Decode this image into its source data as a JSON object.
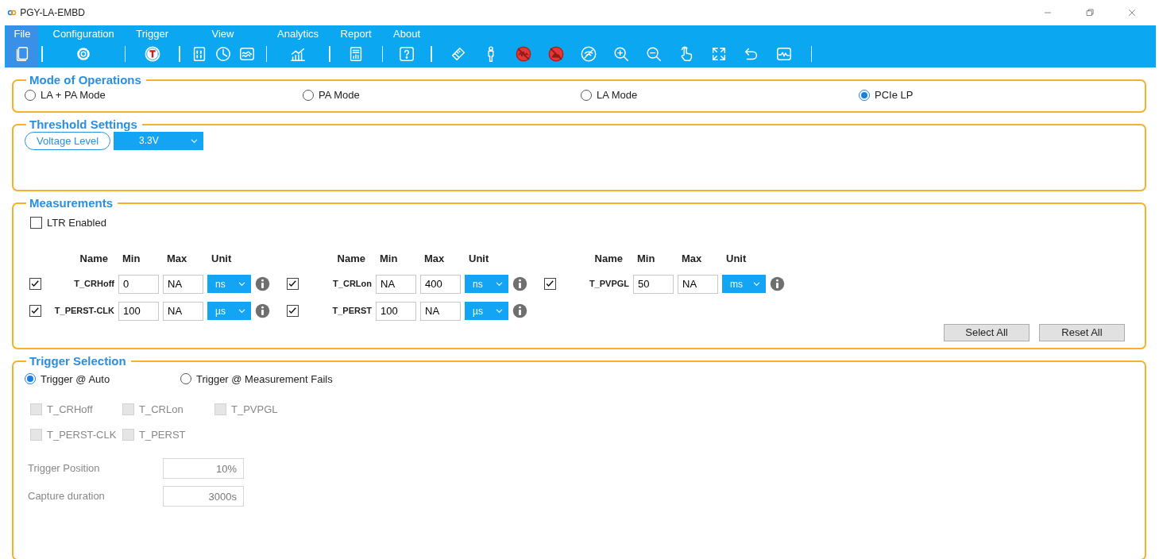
{
  "window": {
    "title": "PGY-LA-EMBD"
  },
  "menu": [
    {
      "label": "File",
      "selected": true
    },
    {
      "label": "Configuration",
      "selected": false
    },
    {
      "label": "Trigger",
      "selected": false
    },
    {
      "label": "View",
      "selected": false
    },
    {
      "label": "Analytics",
      "selected": false
    },
    {
      "label": "Report",
      "selected": false
    },
    {
      "label": "About",
      "selected": false
    }
  ],
  "mode_of_operations": {
    "title": "Mode of Operations",
    "options": [
      {
        "label": "LA + PA Mode",
        "selected": false
      },
      {
        "label": "PA Mode",
        "selected": false
      },
      {
        "label": "LA Mode",
        "selected": false
      },
      {
        "label": "PCIe LP",
        "selected": true
      }
    ]
  },
  "threshold_settings": {
    "title": "Threshold Settings",
    "voltage_label": "Voltage Level",
    "voltage_value": "3.3V"
  },
  "measurements": {
    "title": "Measurements",
    "ltr": {
      "label": "LTR Enabled",
      "checked": false
    },
    "groups": [
      {
        "headers": [
          "Name",
          "Min",
          "Max",
          "Unit"
        ],
        "items": [
          {
            "name": "T_CRHoff",
            "checked": true,
            "min": "0",
            "max": "NA",
            "unit": "ns"
          },
          {
            "name": "T_PERST-CLK",
            "checked": true,
            "min": "100",
            "max": "NA",
            "unit": "µs"
          }
        ]
      },
      {
        "headers": [
          "Name",
          "Min",
          "Max",
          "Unit"
        ],
        "items": [
          {
            "name": "T_CRLon",
            "checked": true,
            "min": "NA",
            "max": "400",
            "unit": "ns"
          },
          {
            "name": "T_PERST",
            "checked": true,
            "min": "100",
            "max": "NA",
            "unit": "µs"
          }
        ]
      },
      {
        "headers": [
          "Name",
          "Min",
          "Max",
          "Unit"
        ],
        "items": [
          {
            "name": "T_PVPGL",
            "checked": true,
            "min": "50",
            "max": "NA",
            "unit": "ms"
          }
        ]
      }
    ],
    "buttons": [
      "Select All",
      "Reset All"
    ]
  },
  "trigger_selection": {
    "title": "Trigger Selection",
    "modes": [
      {
        "label": "Trigger @ Auto",
        "selected": true
      },
      {
        "label": "Trigger @ Measurement Fails",
        "selected": false
      }
    ],
    "signals": [
      {
        "label": "T_CRHoff",
        "checked": false,
        "disabled": true
      },
      {
        "label": "T_CRLon",
        "checked": false,
        "disabled": true
      },
      {
        "label": "T_PVPGL",
        "checked": false,
        "disabled": true
      },
      {
        "label": "T_PERST-CLK",
        "checked": false,
        "disabled": true
      },
      {
        "label": "T_PERST",
        "checked": false,
        "disabled": true
      }
    ],
    "fields": [
      {
        "label": "Trigger Position",
        "value": "10%",
        "disabled": true
      },
      {
        "label": "Capture duration",
        "value": "3000s",
        "disabled": true
      }
    ]
  }
}
